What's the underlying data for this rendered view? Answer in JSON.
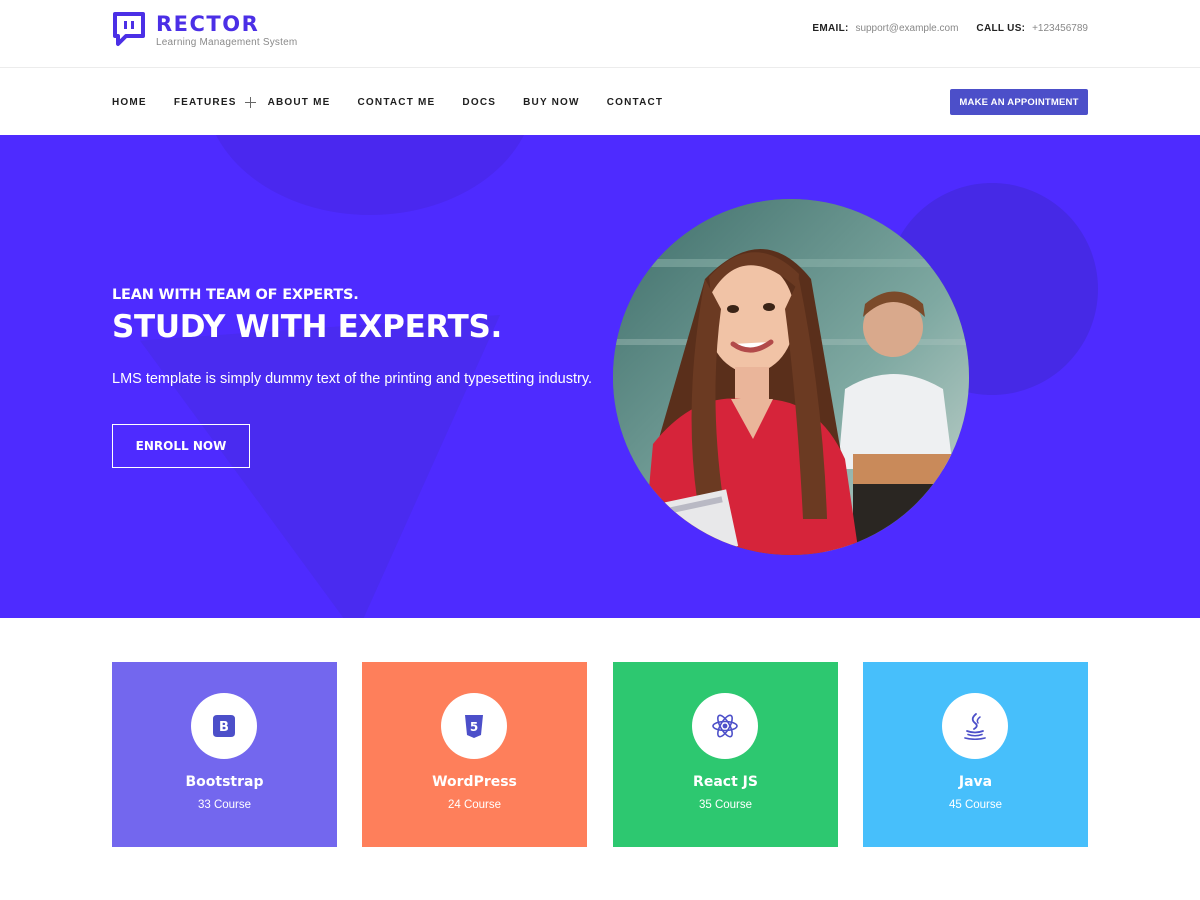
{
  "brand": {
    "name": "RECTOR",
    "tagline": "Learning Management System",
    "color": "#4b2fe6"
  },
  "header": {
    "email_label": "EMAIL:",
    "email_value": "support@example.com",
    "call_label": "CALL US:",
    "call_value": "+123456789"
  },
  "nav": {
    "items": [
      {
        "label": "HOME"
      },
      {
        "label": "FEATURES",
        "icon": "plus-icon"
      },
      {
        "label": "ABOUT ME"
      },
      {
        "label": "CONTACT ME"
      },
      {
        "label": "DOCS"
      },
      {
        "label": "BUY NOW"
      },
      {
        "label": "CONTACT"
      }
    ],
    "cta_label": "MAKE AN APPOINTMENT"
  },
  "hero": {
    "subtitle": "LEAN WITH TEAM OF EXPERTS.",
    "title": "STUDY WITH EXPERTS.",
    "description": "LMS template is simply dummy text of the printing and typesetting industry.",
    "button_label": "ENROLL NOW",
    "background_color": "#4e2bff"
  },
  "courses": [
    {
      "name": "Bootstrap",
      "count": "33 Course",
      "icon": "bootstrap-icon",
      "color": "#7367ee"
    },
    {
      "name": "WordPress",
      "count": "24 Course",
      "icon": "html5-icon",
      "color": "#fe7f5b"
    },
    {
      "name": "React JS",
      "count": "35 Course",
      "icon": "react-icon",
      "color": "#2dc870"
    },
    {
      "name": "Java",
      "count": "45 Course",
      "icon": "java-icon",
      "color": "#47bffb"
    }
  ]
}
